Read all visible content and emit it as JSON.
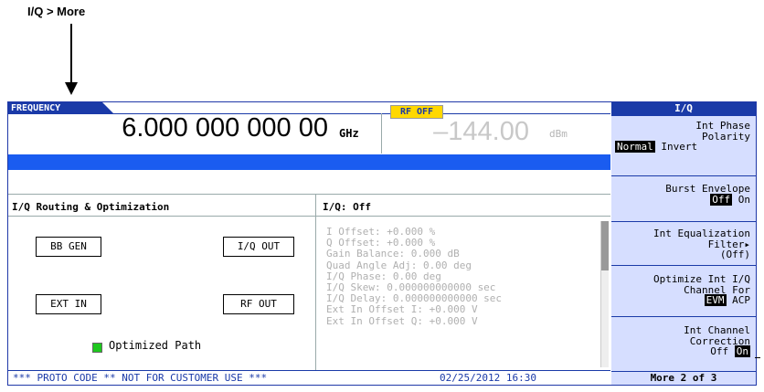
{
  "caption": "I/Q > More",
  "header": {
    "frequency_tab": "FREQUENCY",
    "frequency_value": "6.000 000 000 00",
    "frequency_unit": "GHz",
    "rf_status": "RF OFF",
    "amplitude_value": "–144.00",
    "amplitude_unit": "dBm"
  },
  "routing": {
    "title": "I/Q Routing & Optimization",
    "boxes": [
      "BB GEN",
      "I/Q OUT",
      "EXT IN",
      "RF OUT"
    ],
    "legend": "Optimized Path"
  },
  "iq_panel": {
    "title": "I/Q:  Off",
    "lines": [
      "I Offset: +0.000 %",
      "Q Offset: +0.000 %",
      "Gain Balance: 0.000 dB",
      "Quad Angle Adj: 0.00 deg",
      "I/Q Phase: 0.00 deg",
      "I/Q Skew: 0.000000000000  sec",
      "I/Q Delay: 0.000000000000  sec",
      "Ext In Offset I: +0.000 V",
      "Ext In Offset Q: +0.000 V"
    ]
  },
  "status_bar": {
    "message": "*** PROTO CODE ** NOT FOR CUSTOMER USE ***",
    "datetime": "02/25/2012 16:30"
  },
  "softkeys": {
    "title": "I/Q",
    "int_phase": {
      "line1": "Int Phase",
      "line2": "Polarity",
      "opt_a": "Normal",
      "opt_b": "Invert"
    },
    "burst": {
      "line1": "Burst Envelope",
      "opt_a": "Off",
      "opt_b": "On"
    },
    "equalization": {
      "line1": "Int Equalization",
      "line2": "Filter▸",
      "line3": "(Off)"
    },
    "optimize": {
      "line1": "Optimize Int I/Q",
      "line2": "Channel For",
      "opt_a": "EVM",
      "opt_b": "ACP"
    },
    "correction": {
      "line1": "Int Channel",
      "line2": "Correction",
      "opt_a": "Off",
      "opt_b": "On"
    },
    "more": "More 2 of 3"
  },
  "colors": {
    "accent": "#1a3aa8",
    "blue_bar": "#1a5cf0",
    "rf_off_badge": "#ffd800",
    "softkey_bg": "#d6deff",
    "optimized_legend": "#1ec81e"
  }
}
